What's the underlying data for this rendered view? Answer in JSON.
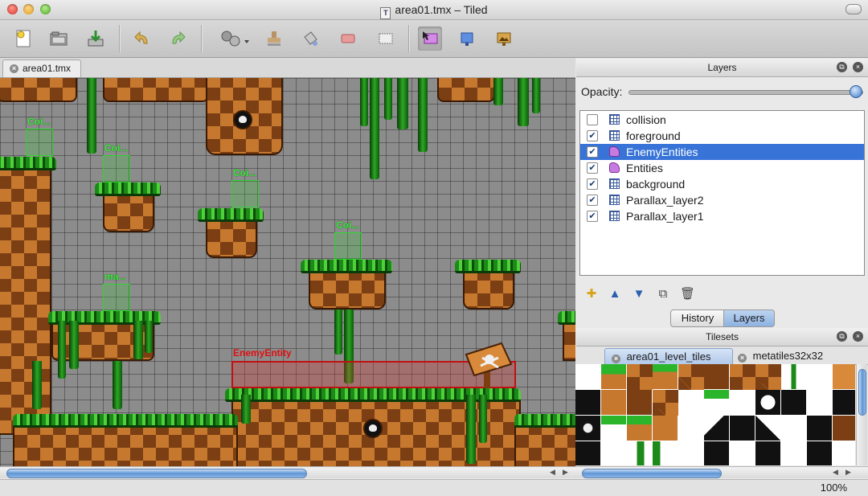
{
  "window": {
    "title": "area01.tmx – Tiled",
    "title_icon": "T"
  },
  "toolbar": {
    "buttons": [
      {
        "name": "new-map",
        "icon": "new-document-icon"
      },
      {
        "name": "open",
        "icon": "open-folder-icon"
      },
      {
        "name": "save",
        "icon": "save-download-icon"
      },
      {
        "name": "undo",
        "icon": "undo-icon"
      },
      {
        "name": "redo",
        "icon": "redo-icon"
      },
      {
        "name": "random-mode",
        "icon": "dice-gear-icon"
      },
      {
        "name": "stamp-brush",
        "icon": "stamp-icon"
      },
      {
        "name": "bucket-fill",
        "icon": "bucket-icon"
      },
      {
        "name": "eraser",
        "icon": "eraser-icon"
      },
      {
        "name": "rect-select",
        "icon": "rectangle-select-icon"
      },
      {
        "name": "select-objects",
        "icon": "select-objects-icon"
      },
      {
        "name": "insert-rectangle",
        "icon": "insert-rectangle-icon"
      },
      {
        "name": "insert-image",
        "icon": "insert-image-icon"
      }
    ]
  },
  "document_tab": {
    "label": "area01.tmx"
  },
  "map": {
    "coin_labels": [
      "Coi...",
      "Coi...",
      "Coi...",
      "Coi...",
      "ma..."
    ],
    "enemy_label": "EnemyEntity"
  },
  "status": {
    "zoom": "100%"
  },
  "layers_panel": {
    "title": "Layers",
    "opacity_label": "Opacity:",
    "opacity_value": 1.0,
    "layers": [
      {
        "name": "collision",
        "visible": false,
        "type": "tile",
        "selected": false
      },
      {
        "name": "foreground",
        "visible": true,
        "type": "tile",
        "selected": false
      },
      {
        "name": "EnemyEntities",
        "visible": true,
        "type": "object",
        "selected": true
      },
      {
        "name": "Entities",
        "visible": true,
        "type": "object",
        "selected": false
      },
      {
        "name": "background",
        "visible": true,
        "type": "tile",
        "selected": false
      },
      {
        "name": "Parallax_layer2",
        "visible": true,
        "type": "tile",
        "selected": false
      },
      {
        "name": "Parallax_layer1",
        "visible": true,
        "type": "tile",
        "selected": false
      }
    ],
    "tabs": [
      "History",
      "Layers"
    ],
    "active_tab": "Layers"
  },
  "tilesets_panel": {
    "title": "Tilesets",
    "tabs": [
      "area01_level_tiles",
      "metatiles32x32"
    ],
    "active_tab": "area01_level_tiles"
  }
}
